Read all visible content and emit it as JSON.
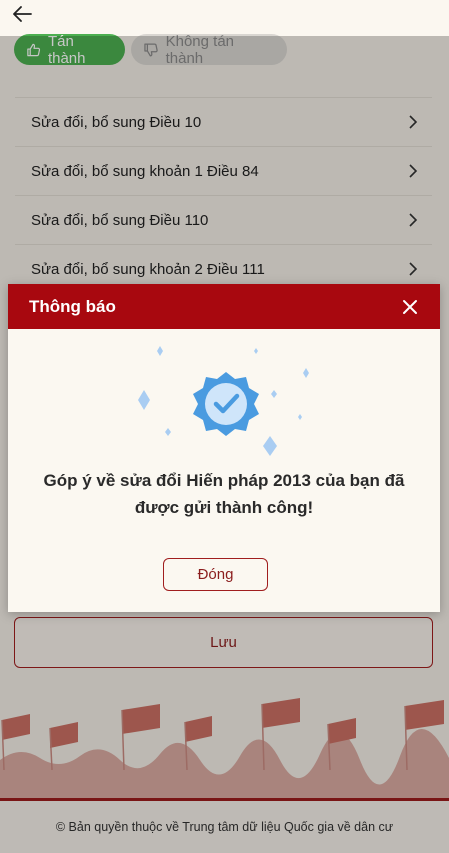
{
  "header": {
    "back_icon": "arrow-left-icon"
  },
  "vote": {
    "agree_label": "Tán thành",
    "disagree_label": "Không tán thành",
    "agree_color": "#4caf50",
    "disagree_color": "#d9d6d1"
  },
  "list": {
    "items": [
      {
        "label": "Sửa đổi, bổ sung Điều 10"
      },
      {
        "label": "Sửa đổi, bổ sung khoản 1 Điều 84"
      },
      {
        "label": "Sửa đổi, bổ sung Điều 110"
      },
      {
        "label": "Sửa đổi, bổ sung khoản 2 Điều 111"
      }
    ]
  },
  "save": {
    "label": "Lưu"
  },
  "footer": {
    "copyright": "© Bản quyền thuộc về Trung tâm dữ liệu Quốc gia về dân cư"
  },
  "modal": {
    "title": "Thông báo",
    "message": "Góp ý về sửa đổi Hiến pháp 2013 của bạn đã được gửi thành công!",
    "close_label": "Đóng",
    "header_color": "#a8080f",
    "icon": "verified-badge-icon"
  }
}
